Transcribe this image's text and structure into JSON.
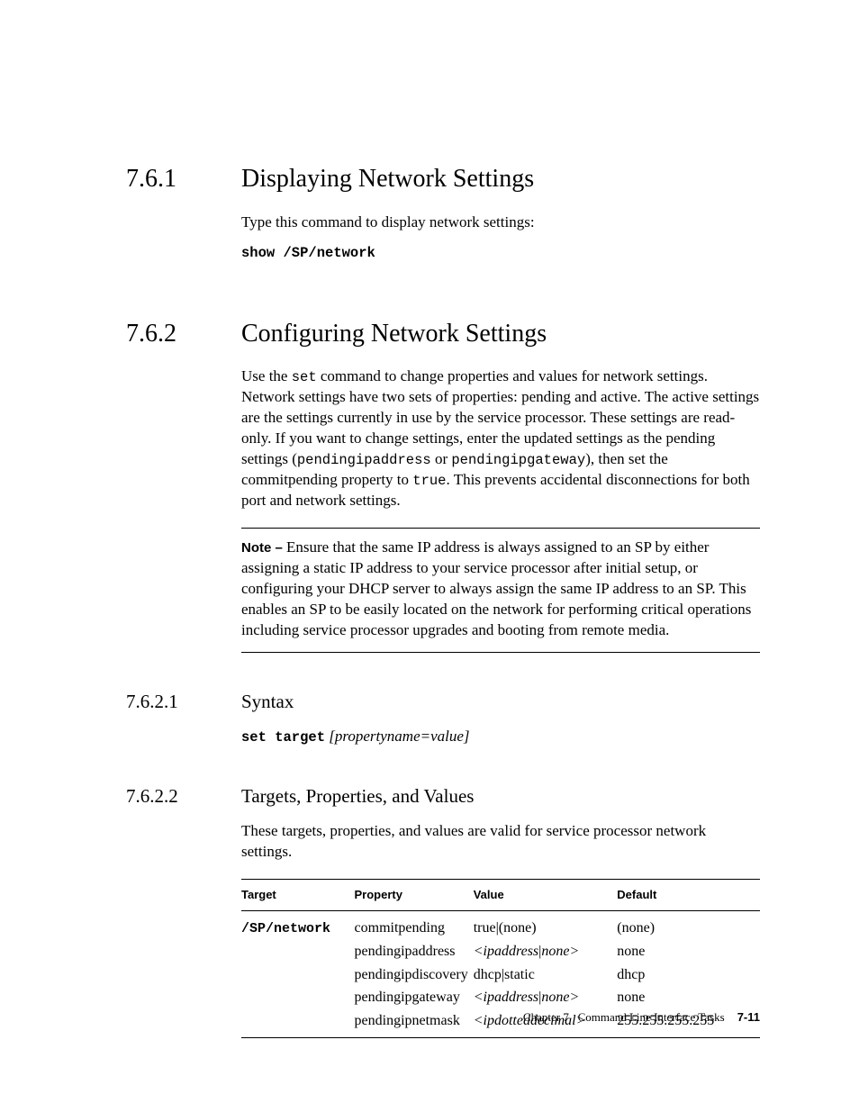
{
  "section_761": {
    "number": "7.6.1",
    "title": "Displaying Network Settings",
    "intro": "Type this command to display network settings:",
    "command": "show /SP/network"
  },
  "section_762": {
    "number": "7.6.2",
    "title": "Configuring Network Settings",
    "para_pre": "Use the ",
    "cmd_set": "set",
    "para_mid1": " command to change properties and values for network settings. Network settings have two sets of properties: pending and active. The active settings are the settings currently in use by the service processor. These settings are read-only. If you want to change settings, enter the updated settings as the pending settings (",
    "code_pia": "pendingipaddress",
    "para_or": " or ",
    "code_pig": "pendingipgateway",
    "para_mid2": "), then set the commitpending property to ",
    "code_true": "true",
    "para_end": ". This prevents accidental disconnections for both port and network settings.",
    "note_label": "Note – ",
    "note_body": "Ensure that the same IP address is always assigned to an SP by either assigning a static IP address to your service processor after initial setup, or configuring your DHCP server to always assign the same IP address to an SP. This enables an SP to be easily located on the network for performing critical operations including service processor upgrades and booting from remote media."
  },
  "section_7621": {
    "number": "7.6.2.1",
    "title": "Syntax",
    "cmd": "set target",
    "arg": "[propertyname=value]"
  },
  "section_7622": {
    "number": "7.6.2.2",
    "title": "Targets, Properties, and Values",
    "intro": "These targets, properties, and values are valid for service processor network settings.",
    "headers": {
      "c1": "Target",
      "c2": "Property",
      "c3": "Value",
      "c4": "Default"
    },
    "target_cell": "/SP/network",
    "rows": [
      {
        "property": "commitpending",
        "value_pre": "true",
        "value_sep": "|",
        "value_post": "(none)",
        "default": "(none)"
      },
      {
        "property": "pendingipaddress",
        "value_pre": "<ipaddress",
        "value_sep": "|",
        "value_post": "none>",
        "default": "none"
      },
      {
        "property": "pendingipdiscovery",
        "value_pre": "dhcp",
        "value_sep": "|",
        "value_post": "static",
        "default": "dhcp"
      },
      {
        "property": "pendingipgateway",
        "value_pre": "<ipaddress",
        "value_sep": "|",
        "value_post": "none>",
        "default": "none"
      },
      {
        "property": "pendingipnetmask",
        "value_pre": "<ipdotteddecimal>",
        "value_sep": "",
        "value_post": "",
        "default": "255.255.255.255"
      }
    ]
  },
  "footer": {
    "chapter": "Chapter 7",
    "title": "Command Line Interface Tasks",
    "page": "7-11"
  }
}
